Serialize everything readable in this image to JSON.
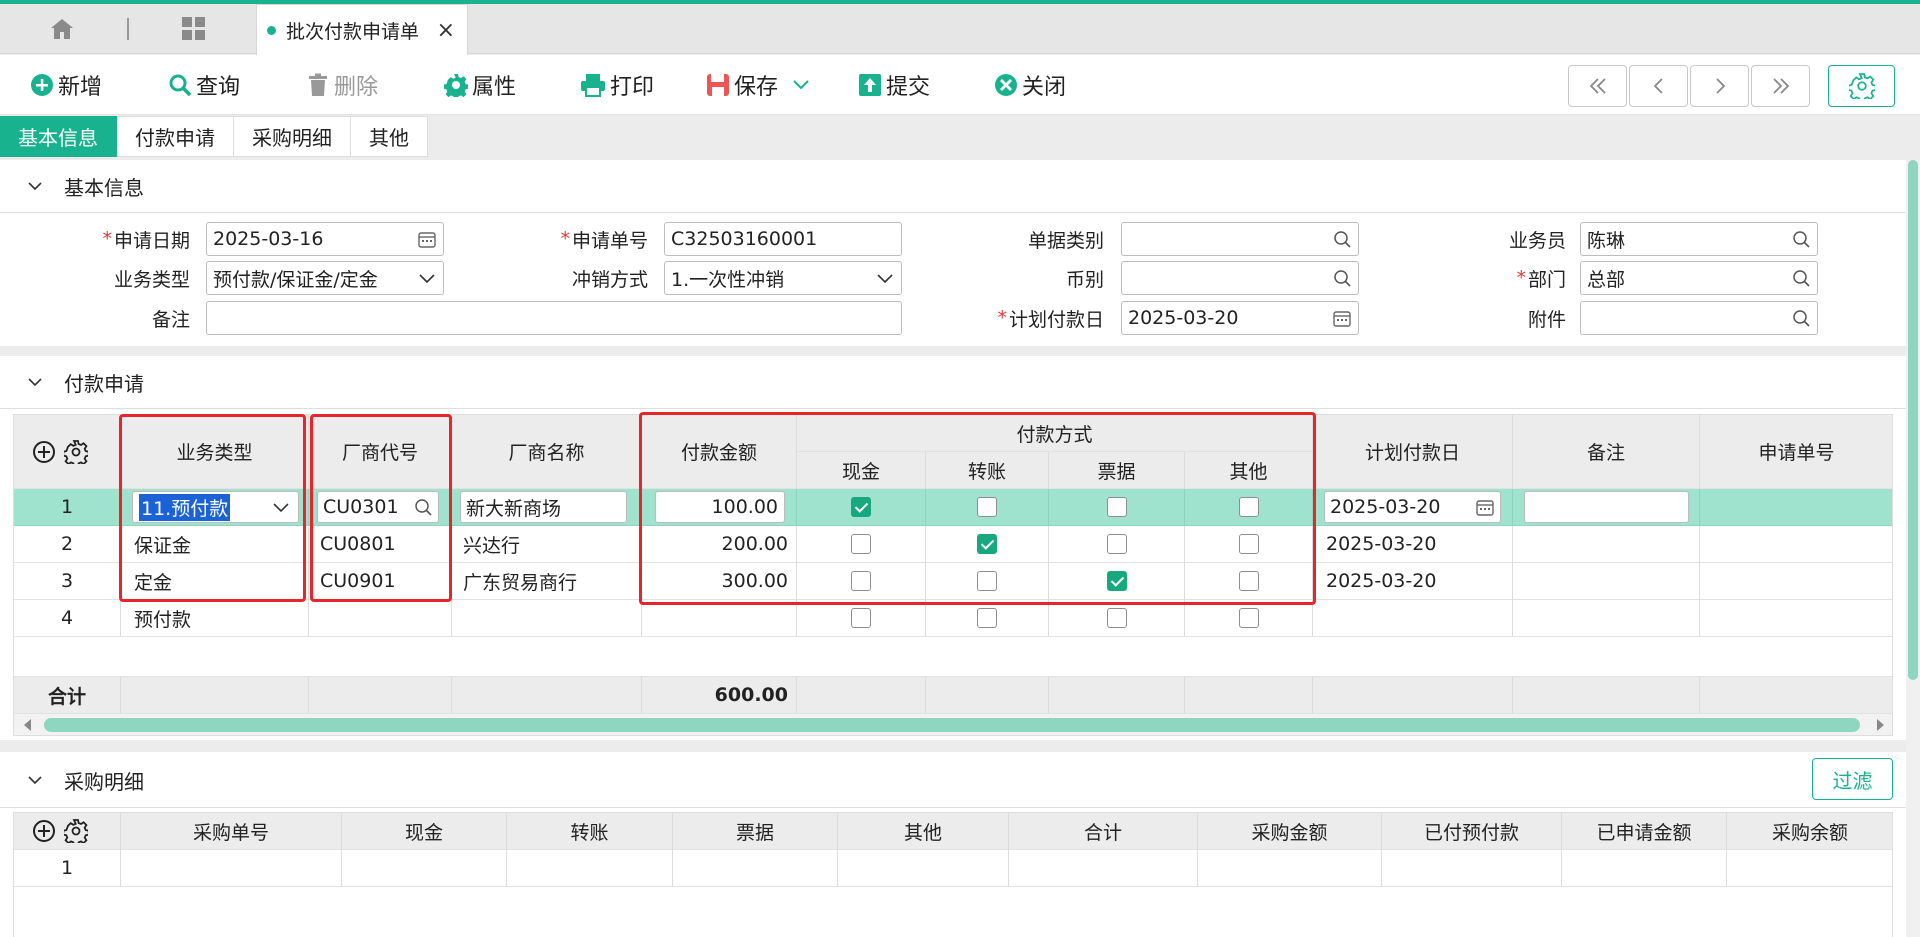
{
  "window": {
    "tab_title": "批次付款申请单",
    "close_glyph": "×"
  },
  "toolbar": {
    "add": "新增",
    "query": "查询",
    "delete": "删除",
    "props": "属性",
    "print": "打印",
    "save": "保存",
    "submit": "提交",
    "close": "关闭"
  },
  "subtabs": [
    "基本信息",
    "付款申请",
    "采购明细",
    "其他"
  ],
  "basic": {
    "title": "基本信息",
    "labels": {
      "apply_date": "申请日期",
      "apply_no": "申请单号",
      "doc_type": "单据类别",
      "salesman": "业务员",
      "biz_type": "业务类型",
      "writeoff": "冲销方式",
      "currency": "币别",
      "dept": "部门",
      "remark": "备注",
      "plan_date": "计划付款日",
      "attach": "附件"
    },
    "values": {
      "apply_date": "2025-03-16",
      "apply_no": "C32503160001",
      "doc_type": "",
      "salesman": "陈琳",
      "biz_type": "预付款/保证金/定金",
      "writeoff": "1.一次性冲销",
      "currency": "",
      "dept": "总部",
      "remark": "",
      "plan_date": "2025-03-20",
      "attach": ""
    }
  },
  "payment": {
    "title": "付款申请",
    "headers": {
      "biz_type": "业务类型",
      "vendor_code": "厂商代号",
      "vendor_name": "厂商名称",
      "amount": "付款金额",
      "method": "付款方式",
      "cash": "现金",
      "transfer": "转账",
      "bill": "票据",
      "other": "其他",
      "plan_date": "计划付款日",
      "remark": "备注",
      "apply_no": "申请单号"
    },
    "rows": [
      {
        "no": "1",
        "biz_type": "11.预付款",
        "vendor_code": "CU0301",
        "vendor_name": "新大新商场",
        "amount": "100.00",
        "cash": true,
        "transfer": false,
        "bill": false,
        "other": false,
        "plan_date": "2025-03-20",
        "remark": "",
        "apply_no": ""
      },
      {
        "no": "2",
        "biz_type": "保证金",
        "vendor_code": "CU0801",
        "vendor_name": "兴达行",
        "amount": "200.00",
        "cash": false,
        "transfer": true,
        "bill": false,
        "other": false,
        "plan_date": "2025-03-20",
        "remark": "",
        "apply_no": ""
      },
      {
        "no": "3",
        "biz_type": "定金",
        "vendor_code": "CU0901",
        "vendor_name": "广东贸易商行",
        "amount": "300.00",
        "cash": false,
        "transfer": false,
        "bill": true,
        "other": false,
        "plan_date": "2025-03-20",
        "remark": "",
        "apply_no": ""
      },
      {
        "no": "4",
        "biz_type": "预付款",
        "vendor_code": "",
        "vendor_name": "",
        "amount": "",
        "cash": false,
        "transfer": false,
        "bill": false,
        "other": false,
        "plan_date": "",
        "remark": "",
        "apply_no": ""
      }
    ],
    "total_label": "合计",
    "total_amount": "600.00"
  },
  "purchase": {
    "title": "采购明细",
    "filter": "过滤",
    "headers": [
      "采购单号",
      "现金",
      "转账",
      "票据",
      "其他",
      "合计",
      "采购金额",
      "已付预付款",
      "已申请金额",
      "采购余额"
    ],
    "rows": [
      {
        "no": "1"
      }
    ]
  },
  "colors": {
    "accent": "#18b38e",
    "selected_row": "#9fe3cf",
    "highlight": "#e8262a"
  }
}
